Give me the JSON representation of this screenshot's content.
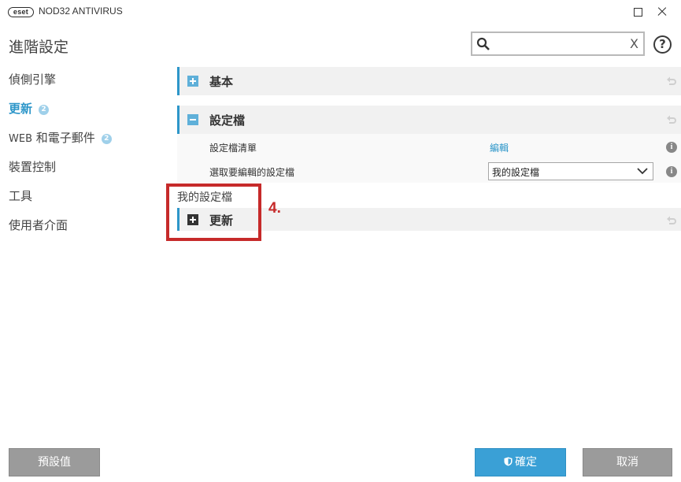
{
  "titlebar": {
    "logo": "eset",
    "product": "NOD32 ANTIVIRUS",
    "icons": {
      "maximize": "maximize-icon",
      "close": "close-icon"
    }
  },
  "header": {
    "title": "進階設定",
    "search": {
      "value": "",
      "placeholder": "",
      "clear": "X"
    },
    "help": "?"
  },
  "sidebar": {
    "items": [
      {
        "label": "偵側引擎"
      },
      {
        "label": "更新",
        "badge": "2",
        "active": true
      },
      {
        "label_prefix": "WEB",
        "label": " 和電子郵件",
        "badge": "2"
      },
      {
        "label": "裝置控制"
      },
      {
        "label": "工具"
      },
      {
        "label": "使用者介面"
      }
    ]
  },
  "main": {
    "sections": [
      {
        "title": "基本",
        "expanded": false
      },
      {
        "title": "設定檔",
        "expanded": true,
        "rows": [
          {
            "label": "設定檔清單",
            "value": "編輯",
            "info": "i"
          },
          {
            "label": "選取要編輯的設定檔",
            "value": "我的設定檔",
            "info": "i"
          }
        ]
      }
    ],
    "profile_group": {
      "label": "我的設定檔",
      "section": {
        "title": "更新",
        "expanded": false
      }
    },
    "callout": "4."
  },
  "footer": {
    "default_button": "預設值",
    "ok_button": "確定",
    "cancel_button": "取消"
  },
  "colors": {
    "accent": "#2d96c9",
    "callout": "#c62a2a",
    "button_gray": "#9b9b9b",
    "button_blue": "#3aa0d6"
  }
}
